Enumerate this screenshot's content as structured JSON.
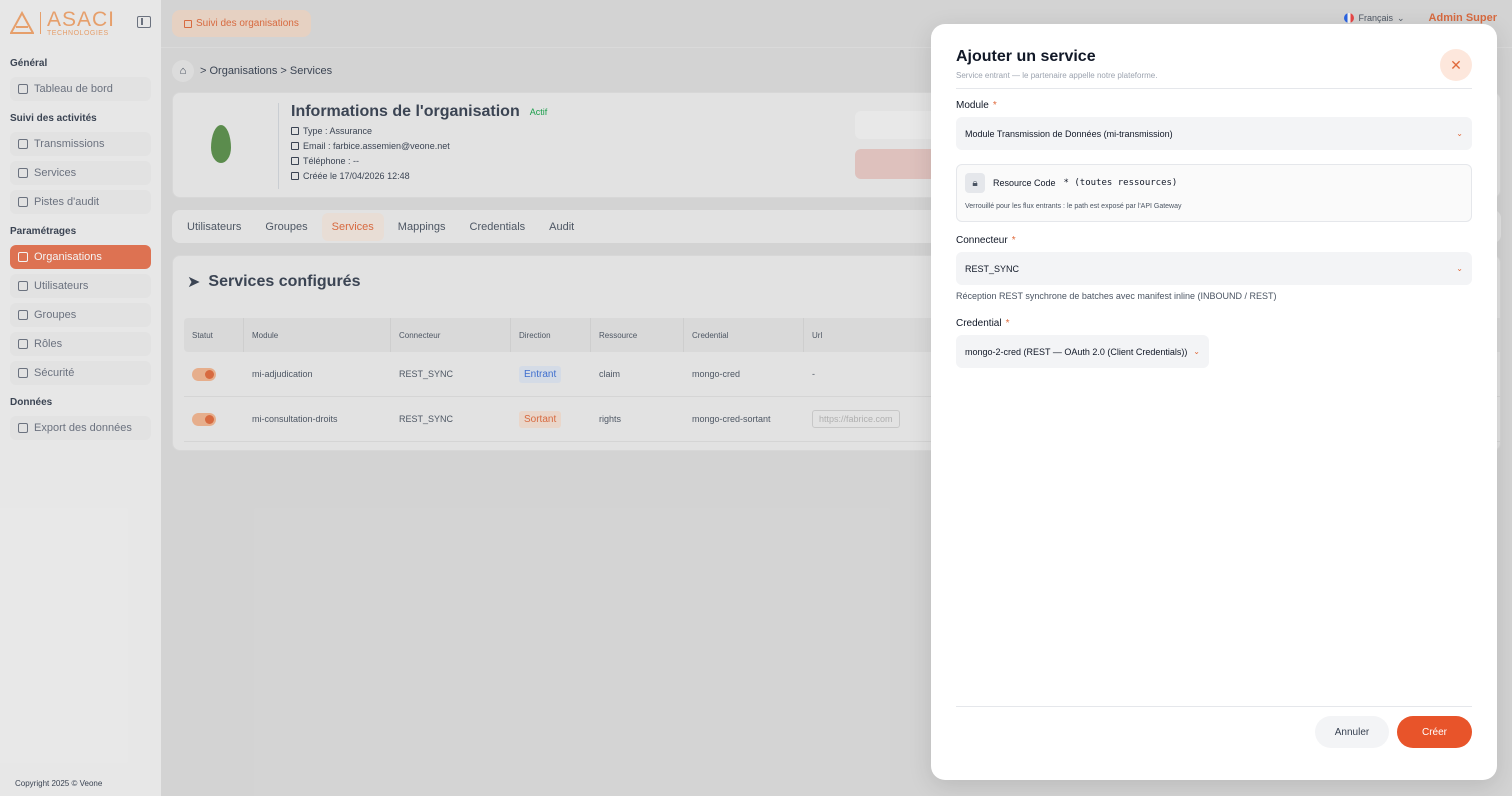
{
  "sidebar": {
    "logo_name": "ASACI",
    "logo_sub": "TECHNOLOGIES",
    "sections": [
      {
        "title": "Général",
        "items": [
          {
            "label": "Tableau de bord"
          }
        ]
      },
      {
        "title": "Suivi des activités",
        "items": [
          {
            "label": "Transmissions"
          },
          {
            "label": "Services"
          },
          {
            "label": "Pistes d'audit"
          }
        ]
      },
      {
        "title": "Paramétrages",
        "items": [
          {
            "label": "Organisations"
          },
          {
            "label": "Utilisateurs"
          },
          {
            "label": "Groupes"
          },
          {
            "label": "Rôles"
          },
          {
            "label": "Sécurité"
          }
        ]
      },
      {
        "title": "Données",
        "items": [
          {
            "label": "Export des données"
          }
        ]
      }
    ],
    "active_item": "Organisations",
    "copyright": "Copyright 2025 © Veone"
  },
  "topbar": {
    "tab_label": "Suivi des organisations",
    "language": "Français",
    "user_name": "Admin Super"
  },
  "breadcrumb": {
    "path": "> Organisations > Services"
  },
  "organization": {
    "title": "Informations de l'organisation",
    "status": "Actif",
    "type": "Type : Assurance",
    "email": "Email : farbice.assemien@veone.net",
    "phone": "Téléphone : --",
    "created": "Créée le 17/04/2026 12:48"
  },
  "tabs": [
    "Utilisateurs",
    "Groupes",
    "Services",
    "Mappings",
    "Credentials",
    "Audit"
  ],
  "active_tab": "Services",
  "services": {
    "title": "Services configurés",
    "columns": [
      "Statut",
      "Module",
      "Connecteur",
      "Direction",
      "Ressource",
      "Credential",
      "Url"
    ],
    "rows": [
      {
        "module": "mi-adjudication",
        "connector": "REST_SYNC",
        "direction": "Entrant",
        "resource": "claim",
        "credential": "mongo-cred",
        "url": "-"
      },
      {
        "module": "mi-consultation-droits",
        "connector": "REST_SYNC",
        "direction": "Sortant",
        "resource": "rights",
        "credential": "mongo-cred-sortant",
        "url": "https://fabrice.com"
      }
    ]
  },
  "modal": {
    "title": "Ajouter un service",
    "subtitle": "Service entrant — le partenaire appelle notre plateforme.",
    "module_label": "Module",
    "module_value": "Module Transmission de Données (mi-transmission)",
    "resource_label": "Resource Code",
    "resource_value": "* (toutes ressources)",
    "resource_hint": "Verrouillé pour les flux entrants : le path est exposé par l'API Gateway",
    "connector_label": "Connecteur",
    "connector_value": "REST_SYNC",
    "connector_desc": "Réception REST synchrone de batches avec manifest inline (INBOUND / REST)",
    "credential_label": "Credential",
    "credential_value": "mongo-2-cred (REST — OAuth 2.0 (Client Credentials))",
    "cancel_label": "Annuler",
    "create_label": "Créer",
    "required_mark": "*"
  },
  "colors": {
    "accent": "#e8542a",
    "accent_soft": "#fde7dc",
    "success": "#16a34a",
    "inbound": "#3b6fd6"
  }
}
